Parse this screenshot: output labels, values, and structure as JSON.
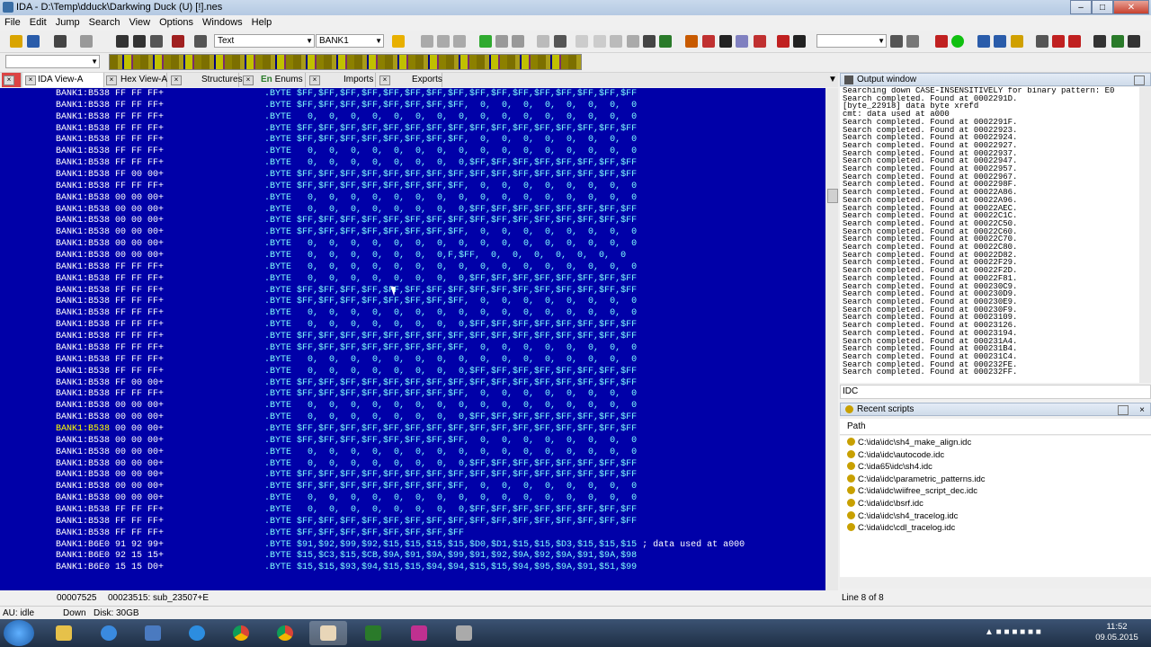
{
  "window": {
    "title": "IDA - D:\\Temp\\dduck\\Darkwing Duck (U) [!].nes"
  },
  "menu": [
    "File",
    "Edit",
    "Jump",
    "Search",
    "View",
    "Options",
    "Windows",
    "Help"
  ],
  "toolbar": {
    "display_combo": "Text",
    "segment_combo": "BANK1",
    "left_combo": "",
    "right_combo": ""
  },
  "tabs": [
    "IDA View-A",
    "Hex View-A",
    "Structures",
    "Enums",
    "Imports",
    "Exports"
  ],
  "tab_enums_prefix": "En",
  "disasm": {
    "lines": [
      {
        "addr": "BANK1:B538",
        "bytes": "FF FF FF+",
        "instr": ".BYTE $FF,$FF,$FF,$FF,$FF,$FF,$FF,$FF,$FF,$FF,$FF,$FF,$FF,$FF,$FF,$FF"
      },
      {
        "addr": "BANK1:B538",
        "bytes": "FF FF FF+",
        "instr": ".BYTE $FF,$FF,$FF,$FF,$FF,$FF,$FF,$FF,  0,  0,  0,  0,  0,  0,  0,  0"
      },
      {
        "addr": "BANK1:B538",
        "bytes": "FF FF FF+",
        "instr": ".BYTE   0,  0,  0,  0,  0,  0,  0,  0,  0,  0,  0,  0,  0,  0,  0,  0"
      },
      {
        "addr": "BANK1:B538",
        "bytes": "FF FF FF+",
        "instr": ".BYTE $FF,$FF,$FF,$FF,$FF,$FF,$FF,$FF,$FF,$FF,$FF,$FF,$FF,$FF,$FF,$FF"
      },
      {
        "addr": "BANK1:B538",
        "bytes": "FF FF FF+",
        "instr": ".BYTE $FF,$FF,$FF,$FF,$FF,$FF,$FF,$FF,  0,  0,  0,  0,  0,  0,  0,  0"
      },
      {
        "addr": "BANK1:B538",
        "bytes": "FF FF FF+",
        "instr": ".BYTE   0,  0,  0,  0,  0,  0,  0,  0,  0,  0,  0,  0,  0,  0,  0,  0"
      },
      {
        "addr": "BANK1:B538",
        "bytes": "FF FF FF+",
        "instr": ".BYTE   0,  0,  0,  0,  0,  0,  0,  0,$FF,$FF,$FF,$FF,$FF,$FF,$FF,$FF"
      },
      {
        "addr": "BANK1:B538",
        "bytes": "FF 00 00+",
        "instr": ".BYTE $FF,$FF,$FF,$FF,$FF,$FF,$FF,$FF,$FF,$FF,$FF,$FF,$FF,$FF,$FF,$FF"
      },
      {
        "addr": "BANK1:B538",
        "bytes": "FF FF FF+",
        "instr": ".BYTE $FF,$FF,$FF,$FF,$FF,$FF,$FF,$FF,  0,  0,  0,  0,  0,  0,  0,  0"
      },
      {
        "addr": "BANK1:B538",
        "bytes": "00 00 00+",
        "instr": ".BYTE   0,  0,  0,  0,  0,  0,  0,  0,  0,  0,  0,  0,  0,  0,  0,  0"
      },
      {
        "addr": "BANK1:B538",
        "bytes": "00 00 00+",
        "instr": ".BYTE   0,  0,  0,  0,  0,  0,  0,  0,$FF,$FF,$FF,$FF,$FF,$FF,$FF,$FF"
      },
      {
        "addr": "BANK1:B538",
        "bytes": "00 00 00+",
        "instr": ".BYTE $FF,$FF,$FF,$FF,$FF,$FF,$FF,$FF,$FF,$FF,$FF,$FF,$FF,$FF,$FF,$FF"
      },
      {
        "addr": "BANK1:B538",
        "bytes": "00 00 00+",
        "instr": ".BYTE $FF,$FF,$FF,$FF,$FF,$FF,$FF,$FF,  0,  0,  0,  0,  0,  0,  0,  0"
      },
      {
        "addr": "BANK1:B538",
        "bytes": "00 00 00+",
        "instr": ".BYTE   0,  0,  0,  0,  0,  0,  0,  0,  0,  0,  0,  0,  0,  0,  0,  0"
      },
      {
        "addr": "BANK1:B538",
        "bytes": "00 00 00+",
        "instr": ".BYTE   0,  0,  0,  0,  0,  0,  0,F,$FF,  0,  0,  0,  0,  0,  0,  0"
      },
      {
        "addr": "BANK1:B538",
        "bytes": "FF FF FF+",
        "instr": ".BYTE   0,  0,  0,  0,  0,  0,  0,  0,  0,  0,  0,  0,  0,  0,  0,  0"
      },
      {
        "addr": "BANK1:B538",
        "bytes": "FF FF FF+",
        "instr": ".BYTE   0,  0,  0,  0,  0,  0,  0,  0,$FF,$FF,$FF,$FF,$FF,$FF,$FF,$FF"
      },
      {
        "addr": "BANK1:B538",
        "bytes": "FF FF FF+",
        "instr": ".BYTE $FF,$FF,$FF,$FF,$FF,$FF,$FF,$FF,$FF,$FF,$FF,$FF,$FF,$FF,$FF,$FF"
      },
      {
        "addr": "BANK1:B538",
        "bytes": "FF FF FF+",
        "instr": ".BYTE $FF,$FF,$FF,$FF,$FF,$FF,$FF,$FF,  0,  0,  0,  0,  0,  0,  0,  0"
      },
      {
        "addr": "BANK1:B538",
        "bytes": "FF FF FF+",
        "instr": ".BYTE   0,  0,  0,  0,  0,  0,  0,  0,  0,  0,  0,  0,  0,  0,  0,  0"
      },
      {
        "addr": "BANK1:B538",
        "bytes": "FF FF FF+",
        "instr": ".BYTE   0,  0,  0,  0,  0,  0,  0,  0,$FF,$FF,$FF,$FF,$FF,$FF,$FF,$FF"
      },
      {
        "addr": "BANK1:B538",
        "bytes": "FF FF FF+",
        "instr": ".BYTE $FF,$FF,$FF,$FF,$FF,$FF,$FF,$FF,$FF,$FF,$FF,$FF,$FF,$FF,$FF,$FF"
      },
      {
        "addr": "BANK1:B538",
        "bytes": "FF FF FF+",
        "instr": ".BYTE $FF,$FF,$FF,$FF,$FF,$FF,$FF,$FF,  0,  0,  0,  0,  0,  0,  0,  0"
      },
      {
        "addr": "BANK1:B538",
        "bytes": "FF FF FF+",
        "instr": ".BYTE   0,  0,  0,  0,  0,  0,  0,  0,  0,  0,  0,  0,  0,  0,  0,  0"
      },
      {
        "addr": "BANK1:B538",
        "bytes": "FF FF FF+",
        "instr": ".BYTE   0,  0,  0,  0,  0,  0,  0,  0,$FF,$FF,$FF,$FF,$FF,$FF,$FF,$FF"
      },
      {
        "addr": "BANK1:B538",
        "bytes": "FF 00 00+",
        "instr": ".BYTE $FF,$FF,$FF,$FF,$FF,$FF,$FF,$FF,$FF,$FF,$FF,$FF,$FF,$FF,$FF,$FF"
      },
      {
        "addr": "BANK1:B538",
        "bytes": "FF FF FF+",
        "instr": ".BYTE $FF,$FF,$FF,$FF,$FF,$FF,$FF,$FF,  0,  0,  0,  0,  0,  0,  0,  0"
      },
      {
        "addr": "BANK1:B538",
        "bytes": "00 00 00+",
        "instr": ".BYTE   0,  0,  0,  0,  0,  0,  0,  0,  0,  0,  0,  0,  0,  0,  0,  0"
      },
      {
        "addr": "BANK1:B538",
        "bytes": "00 00 00+",
        "instr": ".BYTE   0,  0,  0,  0,  0,  0,  0,  0,$FF,$FF,$FF,$FF,$FF,$FF,$FF,$FF"
      },
      {
        "addr": "BANK1:B538",
        "bytes": "00 00 00+",
        "instr": ".BYTE $FF,$FF,$FF,$FF,$FF,$FF,$FF,$FF,$FF,$FF,$FF,$FF,$FF,$FF,$FF,$FF",
        "hl": true
      },
      {
        "addr": "BANK1:B538",
        "bytes": "00 00 00+",
        "instr": ".BYTE $FF,$FF,$FF,$FF,$FF,$FF,$FF,$FF,  0,  0,  0,  0,  0,  0,  0,  0"
      },
      {
        "addr": "BANK1:B538",
        "bytes": "00 00 00+",
        "instr": ".BYTE   0,  0,  0,  0,  0,  0,  0,  0,  0,  0,  0,  0,  0,  0,  0,  0"
      },
      {
        "addr": "BANK1:B538",
        "bytes": "00 00 00+",
        "instr": ".BYTE   0,  0,  0,  0,  0,  0,  0,  0,$FF,$FF,$FF,$FF,$FF,$FF,$FF,$FF"
      },
      {
        "addr": "BANK1:B538",
        "bytes": "00 00 00+",
        "instr": ".BYTE $FF,$FF,$FF,$FF,$FF,$FF,$FF,$FF,$FF,$FF,$FF,$FF,$FF,$FF,$FF,$FF"
      },
      {
        "addr": "BANK1:B538",
        "bytes": "00 00 00+",
        "instr": ".BYTE $FF,$FF,$FF,$FF,$FF,$FF,$FF,$FF,  0,  0,  0,  0,  0,  0,  0,  0"
      },
      {
        "addr": "BANK1:B538",
        "bytes": "00 00 00+",
        "instr": ".BYTE   0,  0,  0,  0,  0,  0,  0,  0,  0,  0,  0,  0,  0,  0,  0,  0"
      },
      {
        "addr": "BANK1:B538",
        "bytes": "FF FF FF+",
        "instr": ".BYTE   0,  0,  0,  0,  0,  0,  0,  0,$FF,$FF,$FF,$FF,$FF,$FF,$FF,$FF"
      },
      {
        "addr": "BANK1:B538",
        "bytes": "FF FF FF+",
        "instr": ".BYTE $FF,$FF,$FF,$FF,$FF,$FF,$FF,$FF,$FF,$FF,$FF,$FF,$FF,$FF,$FF,$FF"
      },
      {
        "addr": "BANK1:B538",
        "bytes": "FF FF FF+",
        "instr": ".BYTE $FF,$FF,$FF,$FF,$FF,$FF,$FF,$FF"
      },
      {
        "addr": "BANK1:B6E0",
        "bytes": "91 92 99+",
        "instr": ".BYTE $91,$92,$99,$92,$15,$15,$15,$15,$D0,$D1,$15,$15,$D3,$15,$15,$15",
        "cmt": " ; data used at a000"
      },
      {
        "addr": "BANK1:B6E0",
        "bytes": "92 15 15+",
        "instr": ".BYTE $15,$C3,$15,$CB,$9A,$91,$9A,$99,$91,$92,$9A,$92,$9A,$91,$9A,$98"
      },
      {
        "addr": "BANK1:B6E0",
        "bytes": "15 15 D0+",
        "instr": ".BYTE $15,$15,$93,$94,$15,$15,$94,$94,$15,$15,$94,$95,$9A,$91,$51,$99"
      }
    ]
  },
  "disasm_status": {
    "offset": "00007525",
    "location": "00023515: sub_23507+E"
  },
  "output": {
    "title": "Output window",
    "lines": [
      "Searching down CASE-INSENSITIVELY for binary pattern: E0",
      "Search completed. Found at 0002291D.",
      "[byte_22918] data byte xrefd",
      "cmt: data used at a000",
      "Search completed. Found at 0002291F.",
      "Search completed. Found at 00022923.",
      "Search completed. Found at 00022924.",
      "Search completed. Found at 00022927.",
      "Search completed. Found at 00022937.",
      "Search completed. Found at 00022947.",
      "Search completed. Found at 00022957.",
      "Search completed. Found at 00022967.",
      "Search completed. Found at 0002298F.",
      "Search completed. Found at 00022A86.",
      "Search completed. Found at 00022A96.",
      "Search completed. Found at 00022AEC.",
      "Search completed. Found at 00022C1C.",
      "Search completed. Found at 00022C50.",
      "Search completed. Found at 00022C60.",
      "Search completed. Found at 00022C70.",
      "Search completed. Found at 00022C80.",
      "Search completed. Found at 00022D82.",
      "Search completed. Found at 00022F29.",
      "Search completed. Found at 00022F2D.",
      "Search completed. Found at 00022F81.",
      "Search completed. Found at 000230C9.",
      "Search completed. Found at 000230D9.",
      "Search completed. Found at 000230E9.",
      "Search completed. Found at 000230F9.",
      "Search completed. Found at 00023109.",
      "Search completed. Found at 00023126.",
      "Search completed. Found at 00023194.",
      "Search completed. Found at 000231A4.",
      "Search completed. Found at 000231B4.",
      "Search completed. Found at 000231C4.",
      "Search completed. Found at 000232FE.",
      "Search completed. Found at 000232FF."
    ],
    "idc_label": "IDC"
  },
  "recent_scripts": {
    "title": "Recent scripts",
    "column": "Path",
    "items": [
      "C:\\ida\\idc\\sh4_make_align.idc",
      "C:\\ida\\idc\\autocode.idc",
      "C:\\ida65\\idc\\sh4.idc",
      "C:\\ida\\idc\\parametric_patterns.idc",
      "C:\\ida\\idc\\wiifree_script_dec.idc",
      "C:\\ida\\idc\\bsrf.idc",
      "C:\\ida\\idc\\sh4_tracelog.idc",
      "C:\\ida\\idc\\cdl_tracelog.idc"
    ],
    "status": "Line 8 of 8"
  },
  "statusbar": {
    "state": "AU:  idle",
    "direction": "Down",
    "disk": "Disk: 30GB"
  },
  "taskbar": {
    "time": "11:52",
    "date": "09.05.2015"
  }
}
